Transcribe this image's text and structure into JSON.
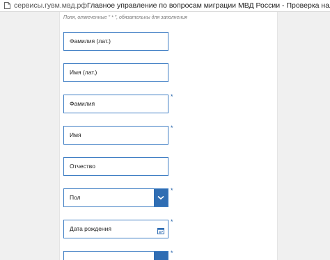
{
  "window": {
    "domain": "сервисы.гувм.мвд.рф",
    "title": "Главное управление по вопросам миграции МВД России - Проверка наличия оснований дл..."
  },
  "form": {
    "required_note": "Поля, отмеченные \" * \", обязательны для заполнения",
    "required_mark": "*",
    "fields": [
      {
        "label": "Фамилия (лат.)",
        "required": false
      },
      {
        "label": "Имя (лат.)",
        "required": false
      },
      {
        "label": "Фамилия",
        "required": true
      },
      {
        "label": "Имя",
        "required": true
      },
      {
        "label": "Отчество",
        "required": false
      },
      {
        "label": "Пол",
        "required": true,
        "type": "select"
      },
      {
        "label": "Дата рождения",
        "required": true,
        "type": "date"
      },
      {
        "label": "",
        "required": true,
        "type": "select"
      }
    ]
  },
  "icons": {
    "site": "document-icon",
    "select": "chevron-down-icon",
    "date": "calendar-icon"
  },
  "colors": {
    "field_border": "#3f7ec4",
    "select_button": "#2f6db3",
    "required_mark": "#1f5fa8"
  }
}
